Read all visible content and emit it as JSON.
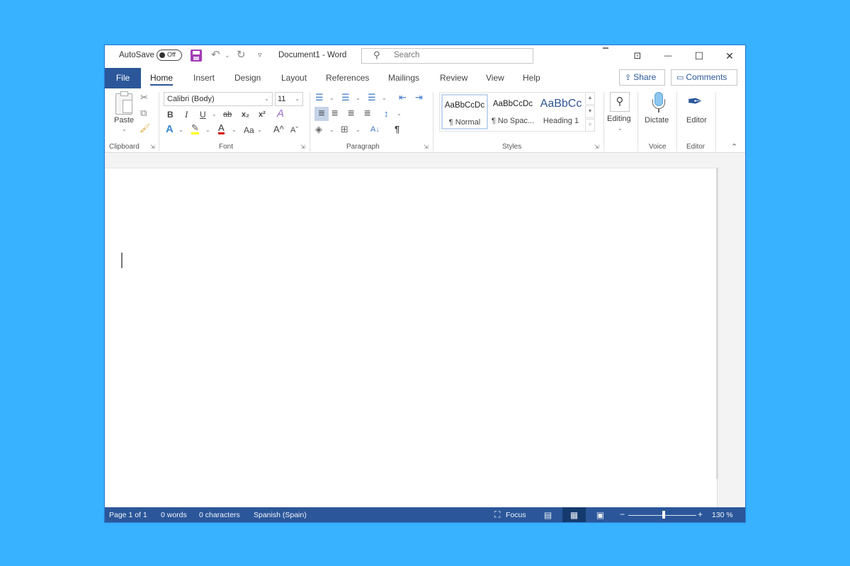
{
  "titlebar": {
    "autosave_label": "AutoSave",
    "autosave_state": "Off",
    "document_title": "Document1  -  Word",
    "search_placeholder": "Search",
    "icons": [
      "save-icon",
      "undo-icon",
      "redo-icon",
      "customize-qat-icon",
      "ribbon-display-options-icon",
      "minimize-icon",
      "maximize-icon",
      "close-icon"
    ],
    "undo_glyph": "↶",
    "redo_glyph": "↻",
    "qat_glyph": "▿",
    "ribbon_display_glyph": "⊡",
    "minimize_glyph": "—",
    "maximize_glyph": "☐",
    "close_glyph": "✕",
    "search_glyph": "⚲"
  },
  "tabs": {
    "file": "File",
    "items": [
      "Home",
      "Insert",
      "Design",
      "Layout",
      "References",
      "Mailings",
      "Review",
      "View",
      "Help"
    ],
    "active": "Home",
    "share": "Share",
    "comments": "Comments",
    "share_glyph": "⇪",
    "comments_glyph": "▭"
  },
  "ribbon": {
    "clipboard": {
      "label": "Clipboard",
      "paste": "Paste",
      "cut_glyph": "✂",
      "copy_glyph": "⧉",
      "format_painter_glyph": "🖌"
    },
    "font": {
      "label": "Font",
      "font_name": "Calibri (Body)",
      "font_size": "11",
      "bold": "B",
      "italic": "I",
      "underline": "U",
      "strikethrough": "ab",
      "subscript": "x₂",
      "superscript": "x²",
      "clear_formatting": "A",
      "text_effects": "A",
      "highlight": "✎",
      "font_color": "A",
      "change_case": "Aa",
      "grow_font": "A^",
      "shrink_font": "Aˇ"
    },
    "paragraph": {
      "label": "Paragraph",
      "bullets_glyph": "☰",
      "numbering_glyph": "☰",
      "multilevel_glyph": "☰",
      "decrease_indent_glyph": "⇤",
      "increase_indent_glyph": "⇥",
      "align_left_glyph": "≡",
      "center_glyph": "≡",
      "align_right_glyph": "≡",
      "justify_glyph": "≡",
      "line_spacing_glyph": "↕",
      "shading_glyph": "◈",
      "borders_glyph": "⊞",
      "sort_glyph": "A↓",
      "show_marks_glyph": "¶",
      "active_alignment": "left"
    },
    "styles": {
      "label": "Styles",
      "items": [
        {
          "sample": "AaBbCcDc",
          "name": "¶ Normal",
          "selected": true
        },
        {
          "sample": "AaBbCcDc",
          "name": "¶ No Spac...",
          "selected": false
        },
        {
          "sample": "AaBbCc",
          "name": "Heading 1",
          "selected": false
        }
      ]
    },
    "editing": {
      "label": "Editing",
      "glyph": "⚲"
    },
    "voice": {
      "label": "Voice",
      "dictate": "Dictate"
    },
    "editor": {
      "label": "Editor",
      "button": "Editor",
      "glyph": "✒"
    },
    "collapse_glyph": "⌃"
  },
  "document": {
    "content": ""
  },
  "statusbar": {
    "page": "Page 1 of 1",
    "words": "0 words",
    "characters": "0 characters",
    "language": "Spanish (Spain)",
    "focus": "Focus",
    "focus_glyph": "⛶",
    "read_mode_glyph": "▤",
    "print_layout_glyph": "▦",
    "web_layout_glyph": "▣",
    "active_view": "print-layout",
    "zoom_minus": "−",
    "zoom_plus": "+",
    "zoom_level": "130 %",
    "zoom_percent": 130
  },
  "colors": {
    "background": "#38b1ff",
    "brand": "#2b579a",
    "save_icon": "#a23cb4",
    "highlight_yellow": "#ffff00",
    "font_color_red": "#d40000",
    "heading_blue": "#2f5597"
  }
}
